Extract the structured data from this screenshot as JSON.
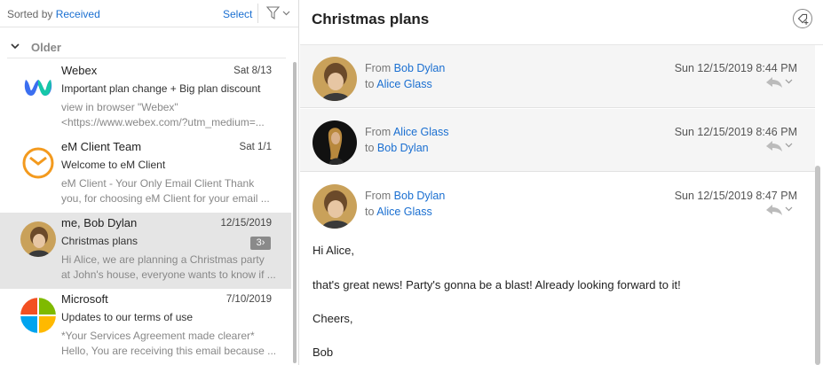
{
  "list": {
    "sorted_prefix": "Sorted by",
    "sorted_field": "Received",
    "select_label": "Select",
    "group_label": "Older",
    "messages": [
      {
        "sender": "Webex",
        "date": "Sat 8/13",
        "subject": "Important plan change + Big plan discount",
        "preview1": "view in browser  \"Webex\"",
        "preview2": "<https://www.webex.com/?utm_medium=...",
        "avatar_icon": "webex-logo-icon"
      },
      {
        "sender": "eM Client Team",
        "date": "Sat 1/1",
        "subject": "Welcome to eM Client",
        "preview1": "eM Client - Your Only Email Client Thank",
        "preview2": "you, for choosing eM Client for your email ...",
        "avatar_icon": "em-client-logo-icon"
      },
      {
        "sender": "me, Bob Dylan",
        "date": "12/15/2019",
        "subject": "Christmas plans",
        "badge": "3",
        "preview1": "Hi Alice,  we are planning a Christmas party",
        "preview2": "at John's house, everyone wants to know if ...",
        "avatar_icon": "bob-dylan-avatar"
      },
      {
        "sender": "Microsoft",
        "date": "7/10/2019",
        "subject": "Updates to our terms of use",
        "preview1": "*Your Services Agreement made clearer*",
        "preview2": "Hello, You are receiving this email because ...",
        "avatar_icon": "microsoft-logo-icon"
      }
    ]
  },
  "reader": {
    "title": "Christmas plans",
    "from_word": "From",
    "to_word": "to",
    "thread": [
      {
        "from": "Bob Dylan",
        "to": "Alice Glass",
        "date": "Sun 12/15/2019 8:44 PM"
      },
      {
        "from": "Alice Glass",
        "to": "Bob Dylan",
        "date": "Sun 12/15/2019 8:46 PM"
      },
      {
        "from": "Bob Dylan",
        "to": "Alice Glass",
        "date": "Sun 12/15/2019 8:47 PM"
      }
    ],
    "body": {
      "greeting": "Hi Alice,",
      "line1": "that's great news! Party's gonna be a blast! Already looking forward to it!",
      "closing": "Cheers,",
      "signature": "Bob"
    }
  },
  "colors": {
    "accent": "#1a6fd1",
    "selected_row": "#e5e5e5",
    "em_orange": "#f39a1e"
  }
}
